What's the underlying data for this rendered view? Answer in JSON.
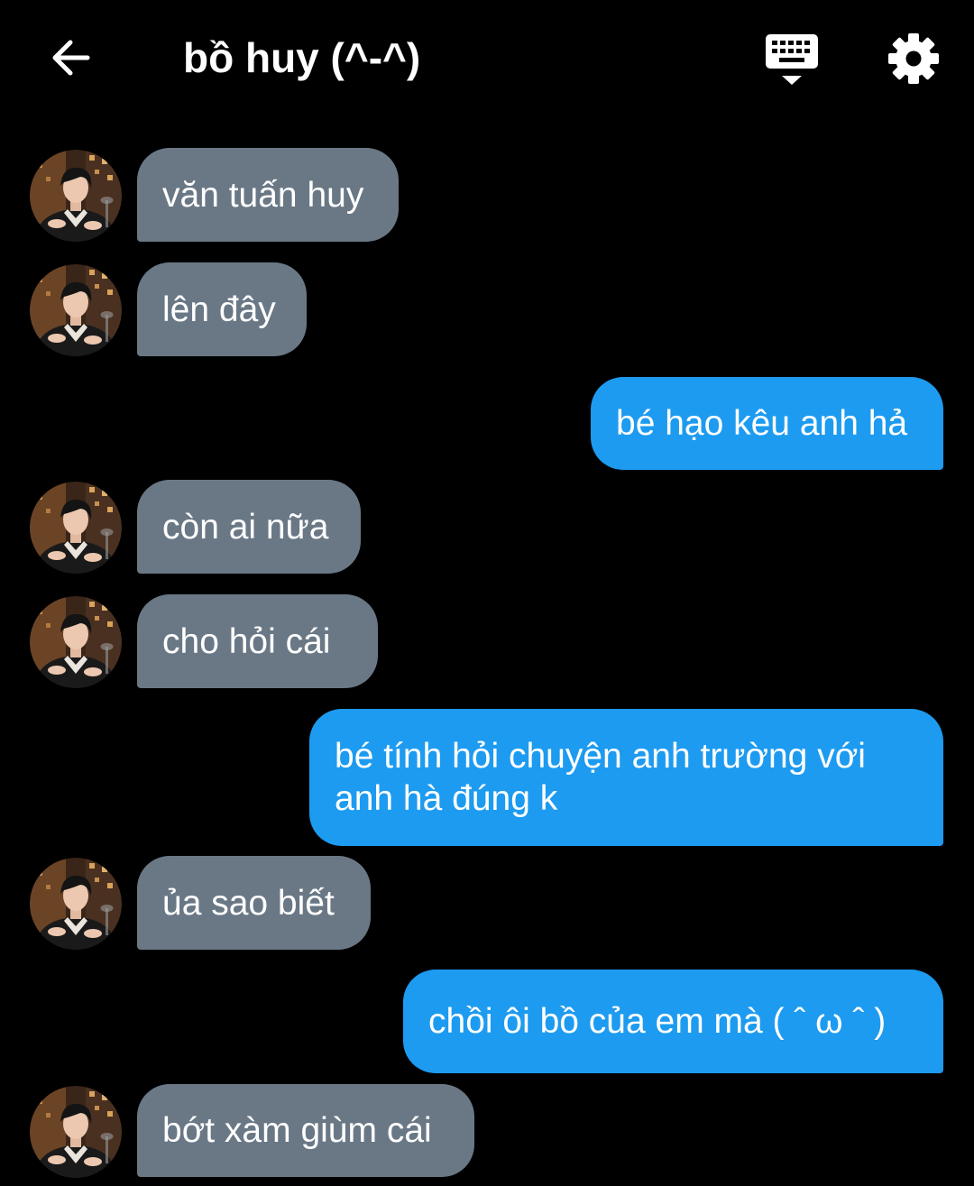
{
  "header": {
    "title": "bồ huy (^-^)",
    "back_icon": "arrow-left-icon",
    "keyboard_icon": "keyboard-icon",
    "settings_icon": "gear-icon"
  },
  "colors": {
    "background": "#000000",
    "incoming_bubble": "#6a7886",
    "outgoing_bubble": "#1d9bf0",
    "text": "#ffffff"
  },
  "messages": [
    {
      "side": "in",
      "text": "văn tuấn huy"
    },
    {
      "side": "in",
      "text": "lên đây"
    },
    {
      "side": "out",
      "text": "bé hạo kêu anh hả"
    },
    {
      "side": "in",
      "text": "còn ai nữa"
    },
    {
      "side": "in",
      "text": "cho hỏi cái"
    },
    {
      "side": "out",
      "text": "bé tính hỏi chuyện anh trường với anh hà đúng k"
    },
    {
      "side": "in",
      "text": "ủa sao biết"
    },
    {
      "side": "out",
      "text": "chồi ôi bồ của em mà ( ˆ ω ˆ )"
    },
    {
      "side": "in",
      "text": "bớt xàm giùm cái"
    }
  ]
}
